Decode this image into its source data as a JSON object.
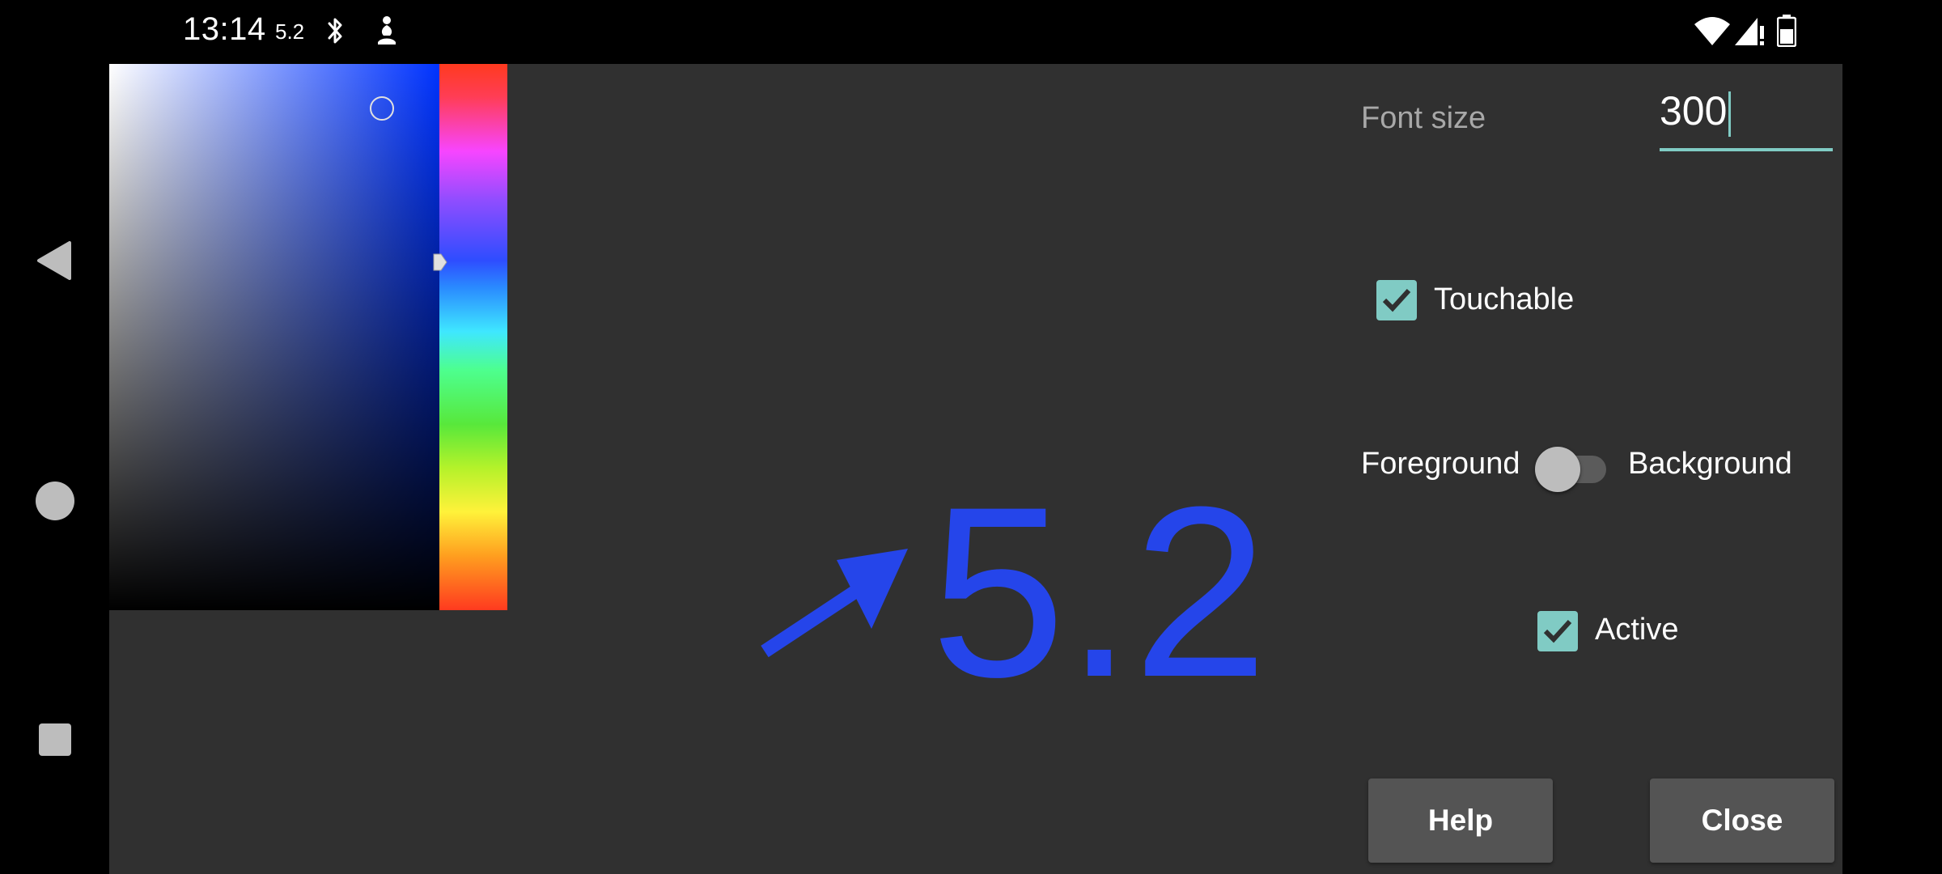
{
  "status_bar": {
    "time": "13:14",
    "indicator": "5.2",
    "icons": [
      "bluetooth-icon",
      "accessibility-icon",
      "wifi-icon",
      "signal-icon",
      "battery-icon"
    ]
  },
  "navigation": {
    "icons": [
      "back-icon",
      "home-icon",
      "recents-icon"
    ]
  },
  "color_picker": {
    "selected_color": "#2545ea",
    "hue_colors": [
      "#ff3a1f",
      "#f745ff",
      "#2e4dff",
      "#3fe7ff",
      "#58e83b",
      "#fff23a"
    ]
  },
  "preview": {
    "icon": "arrow-up-right-icon",
    "text": "5.2",
    "color": "#2545ea"
  },
  "settings": {
    "font_size_label": "Font size",
    "font_size_value": "300",
    "touchable_label": "Touchable",
    "touchable_checked": true,
    "foreground_label": "Foreground",
    "background_label": "Background",
    "toggle_on": false,
    "active_label": "Active",
    "active_checked": true
  },
  "buttons": {
    "help": "Help",
    "close": "Close"
  },
  "colors": {
    "accent": "#80cbc4",
    "dialog_bg": "#303030",
    "button_bg": "#545454"
  }
}
